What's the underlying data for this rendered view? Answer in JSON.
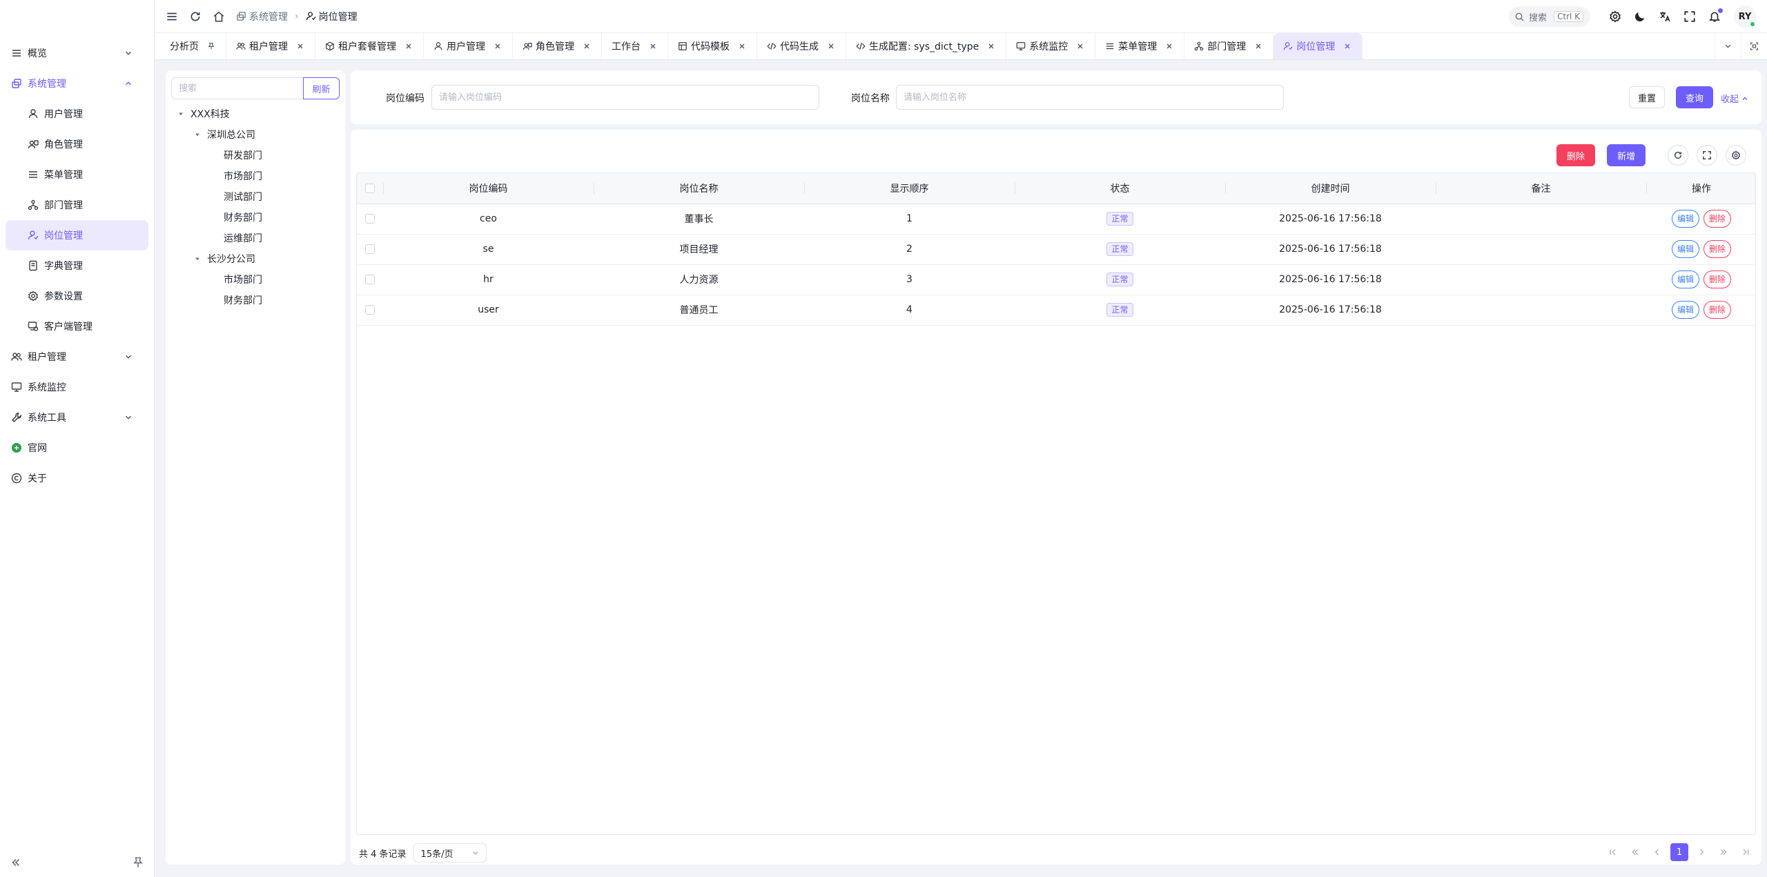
{
  "sidebar": {
    "items": [
      {
        "label": "概览"
      },
      {
        "label": "系统管理"
      },
      {
        "label": "用户管理"
      },
      {
        "label": "角色管理"
      },
      {
        "label": "菜单管理"
      },
      {
        "label": "部门管理"
      },
      {
        "label": "岗位管理"
      },
      {
        "label": "字典管理"
      },
      {
        "label": "参数设置"
      },
      {
        "label": "客户端管理"
      },
      {
        "label": "租户管理"
      },
      {
        "label": "系统监控"
      },
      {
        "label": "系统工具"
      },
      {
        "label": "官网"
      },
      {
        "label": "关于"
      }
    ]
  },
  "header": {
    "breadcrumb": [
      "系统管理",
      "岗位管理"
    ],
    "search_label": "搜索",
    "search_shortcut": "Ctrl K",
    "avatar_text": "RY"
  },
  "tabs": [
    {
      "label": "分析页",
      "icon": "pin-icon"
    },
    {
      "label": "租户管理",
      "icon": "users-icon"
    },
    {
      "label": "租户套餐管理",
      "icon": "box-icon"
    },
    {
      "label": "用户管理",
      "icon": "user-icon"
    },
    {
      "label": "角色管理",
      "icon": "user-card-icon"
    },
    {
      "label": "工作台",
      "icon": ""
    },
    {
      "label": "代码模板",
      "icon": "template-icon"
    },
    {
      "label": "代码生成",
      "icon": "code-icon"
    },
    {
      "label": "生成配置: sys_dict_type",
      "icon": "code-icon"
    },
    {
      "label": "系统监控",
      "icon": "monitor-icon"
    },
    {
      "label": "菜单管理",
      "icon": "menu-icon"
    },
    {
      "label": "部门管理",
      "icon": "tree-icon"
    },
    {
      "label": "岗位管理",
      "icon": "post-icon"
    }
  ],
  "tree": {
    "search_placeholder": "搜索",
    "refresh_label": "刷新",
    "nodes": [
      {
        "label": "XXX科技"
      },
      {
        "label": "深圳总公司"
      },
      {
        "label": "研发部门"
      },
      {
        "label": "市场部门"
      },
      {
        "label": "测试部门"
      },
      {
        "label": "财务部门"
      },
      {
        "label": "运维部门"
      },
      {
        "label": "长沙分公司"
      },
      {
        "label": "市场部门"
      },
      {
        "label": "财务部门"
      }
    ]
  },
  "search_form": {
    "code_label": "岗位编码",
    "code_placeholder": "请输入岗位编码",
    "name_label": "岗位名称",
    "name_placeholder": "请输入岗位名称",
    "reset_label": "重置",
    "query_label": "查询",
    "collapse_label": "收起"
  },
  "toolbar": {
    "delete_label": "删除",
    "add_label": "新增"
  },
  "table": {
    "columns": [
      "岗位编码",
      "岗位名称",
      "显示顺序",
      "状态",
      "创建时间",
      "备注",
      "操作"
    ],
    "rows": [
      {
        "code": "ceo",
        "name": "董事长",
        "order": "1",
        "status": "正常",
        "created": "2025-06-16 17:56:18",
        "remark": ""
      },
      {
        "code": "se",
        "name": "项目经理",
        "order": "2",
        "status": "正常",
        "created": "2025-06-16 17:56:18",
        "remark": ""
      },
      {
        "code": "hr",
        "name": "人力资源",
        "order": "3",
        "status": "正常",
        "created": "2025-06-16 17:56:18",
        "remark": ""
      },
      {
        "code": "user",
        "name": "普通员工",
        "order": "4",
        "status": "正常",
        "created": "2025-06-16 17:56:18",
        "remark": ""
      }
    ],
    "edit_label": "编辑",
    "delete_label": "删除"
  },
  "pagination": {
    "total_text": "共 4 条记录",
    "page_size": "15条/页",
    "current_page": "1"
  },
  "colors": {
    "primary": "#6d5efc",
    "danger": "#f43f5e",
    "edit": "#3b82f6",
    "success": "#2ba24c"
  }
}
